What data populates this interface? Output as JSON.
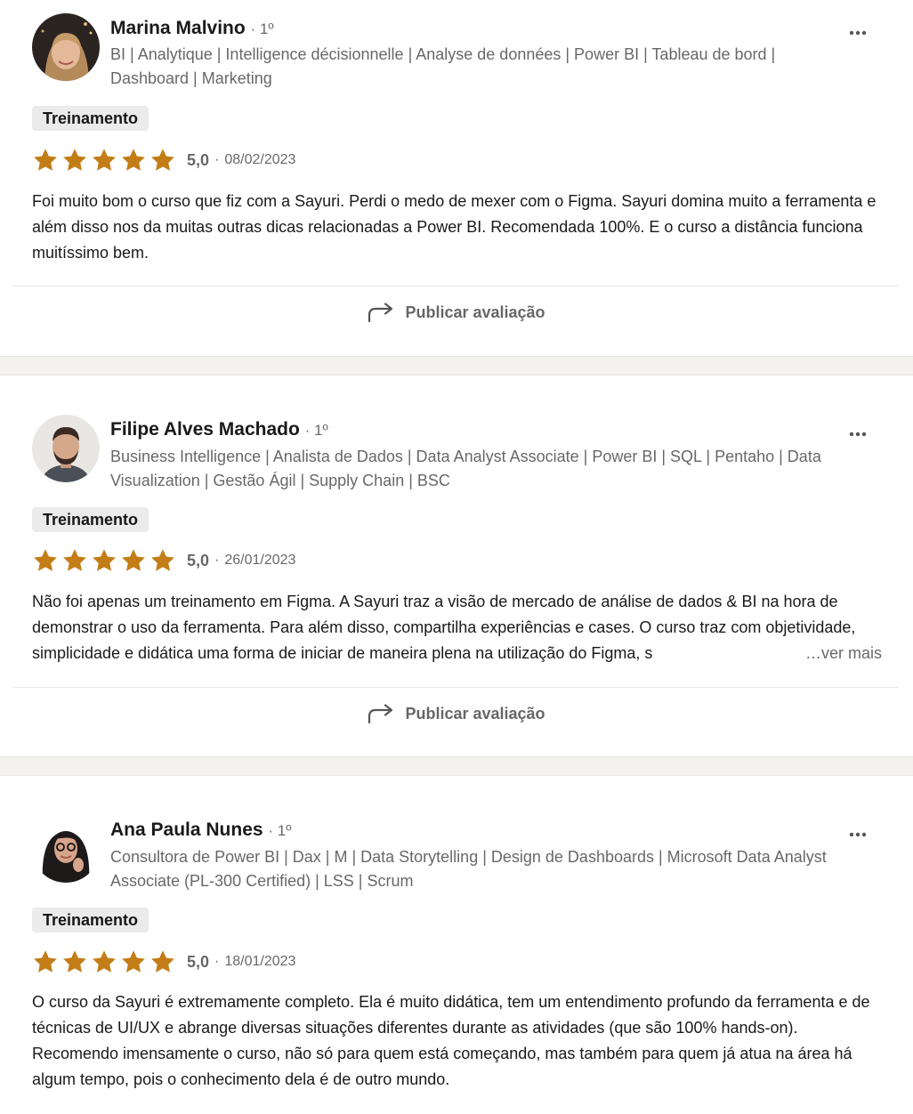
{
  "reviews": [
    {
      "name": "Marina Malvino",
      "degree": "· 1º",
      "headline": "BI | Analytique | Intelligence décisionnelle | Analyse de données | Power BI | Tableau de bord | Dashboard | Marketing",
      "tag": "Treinamento",
      "rating": "5,0",
      "date": "08/02/2023",
      "text": "Foi muito bom o curso que fiz com a Sayuri. Perdi o medo de mexer com o Figma. Sayuri domina muito a ferramenta e além disso nos da muitas outras dicas relacionadas a Power BI. Recomendada 100%. E o curso a distância funciona muitíssimo bem.",
      "action_label": "Publicar avaliação"
    },
    {
      "name": "Filipe Alves Machado",
      "degree": "· 1º",
      "headline": "Business Intelligence | Analista de Dados | Data Analyst Associate | Power BI | SQL | Pentaho | Data Visualization | Gestão Ágil | Supply Chain | BSC",
      "tag": "Treinamento",
      "rating": "5,0",
      "date": "26/01/2023",
      "text": "Não foi apenas um treinamento em Figma. A Sayuri traz a visão de mercado de análise de dados & BI na hora de demonstrar o uso da ferramenta. Para além disso, compartilha experiências e cases. O curso traz com objetividade, simplicidade e didática uma forma de iniciar de maneira plena na utilização do Figma, s",
      "see_more": "…ver mais",
      "action_label": "Publicar avaliação"
    },
    {
      "name": "Ana Paula Nunes",
      "degree": "· 1º",
      "headline": "Consultora de Power BI | Dax | M | Data Storytelling | Design de Dashboards | Microsoft Data Analyst Associate (PL-300 Certified) | LSS | Scrum",
      "tag": "Treinamento",
      "rating": "5,0",
      "date": "18/01/2023",
      "text": "O curso da Sayuri é extremamente completo. Ela é muito didática, tem um entendimento profundo da ferramenta e de técnicas de UI/UX e abrange diversas situações diferentes durante as atividades (que são 100% hands-on). Recomendo imensamente o curso, não só para quem está começando, mas também para quem já atua na área há algum tempo, pois o conhecimento dela é de outro mundo."
    }
  ],
  "colors": {
    "star": "#c37d16",
    "muted_text": "#666666",
    "tag_bg": "#ebebeb"
  },
  "icons": {
    "more": "more-horizontal-icon",
    "share": "share-arrow-icon",
    "star": "star-icon"
  }
}
